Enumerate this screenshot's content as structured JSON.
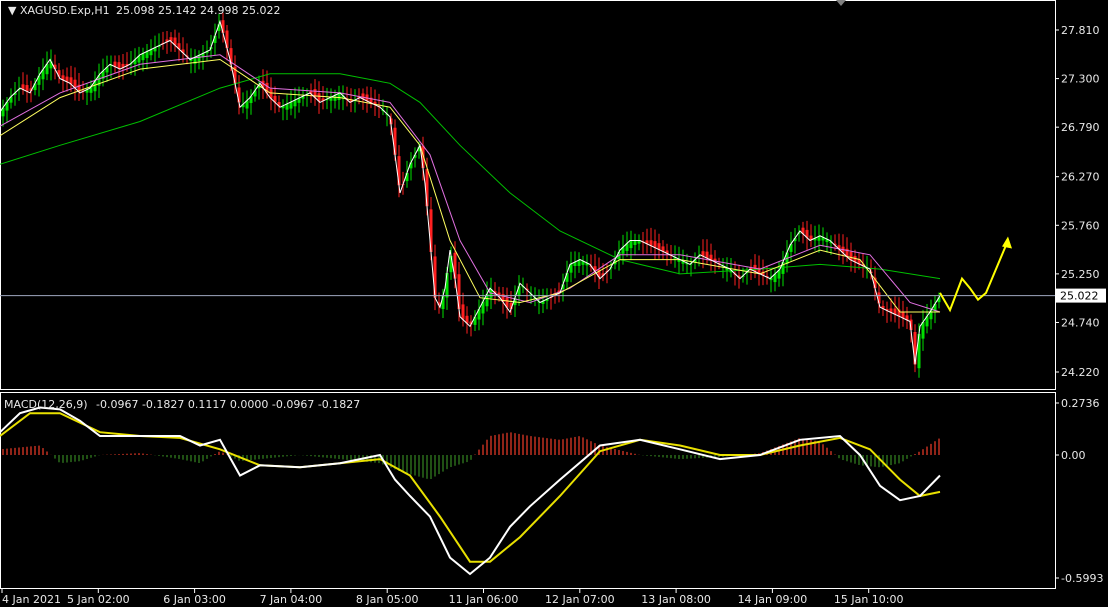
{
  "header": {
    "symbol": "XAGUSD.Exp,H1",
    "ohlc": "25.098 25.142 24.998 25.022"
  },
  "macd_header": {
    "label": "MACD(12,26,9)",
    "values": "-0.0967 -0.1827 0.1117 0.0000 -0.0967 -0.1827"
  },
  "colors": {
    "background": "#000000",
    "axis": "#ffffff",
    "bull": "#00e000",
    "bear": "#ff2020",
    "ma_fast": "#ffffff",
    "ma_mid": "#ffff60",
    "ma_slow": "#e070e0",
    "ma_long": "#00c000",
    "macd_line": "#ffffff",
    "signal_line": "#e8e000",
    "hist_pos": "#c03020",
    "hist_neg": "#2a6a1a",
    "arrow": "#ffff00",
    "current_price_line": "#a0a8c0"
  },
  "chart_data": [
    {
      "type": "candlestick",
      "title": "XAGUSD.Exp,H1",
      "ylim": [
        24.0,
        28.0
      ],
      "y_ticks": [
        "27.810",
        "27.300",
        "26.790",
        "26.270",
        "25.760",
        "25.250",
        "24.740",
        "24.220"
      ],
      "current_price": "25.022",
      "x_ticks": [
        "4 Jan 2021",
        "5 Jan 02:00",
        "6 Jan 03:00",
        "7 Jan 04:00",
        "8 Jan 05:00",
        "11 Jan 06:00",
        "12 Jan 07:00",
        "13 Jan 08:00",
        "14 Jan 09:00",
        "15 Jan 10:00"
      ],
      "close_path": [
        [
          0,
          26.95
        ],
        [
          10,
          27.1
        ],
        [
          20,
          27.2
        ],
        [
          30,
          27.15
        ],
        [
          40,
          27.35
        ],
        [
          50,
          27.5
        ],
        [
          60,
          27.3
        ],
        [
          70,
          27.25
        ],
        [
          80,
          27.15
        ],
        [
          90,
          27.2
        ],
        [
          100,
          27.35
        ],
        [
          110,
          27.45
        ],
        [
          120,
          27.4
        ],
        [
          130,
          27.45
        ],
        [
          140,
          27.55
        ],
        [
          150,
          27.6
        ],
        [
          160,
          27.65
        ],
        [
          170,
          27.7
        ],
        [
          180,
          27.6
        ],
        [
          190,
          27.5
        ],
        [
          200,
          27.55
        ],
        [
          210,
          27.6
        ],
        [
          220,
          27.9
        ],
        [
          230,
          27.5
        ],
        [
          240,
          27.0
        ],
        [
          250,
          27.1
        ],
        [
          260,
          27.25
        ],
        [
          270,
          27.1
        ],
        [
          280,
          27.0
        ],
        [
          290,
          27.05
        ],
        [
          300,
          27.1
        ],
        [
          310,
          27.15
        ],
        [
          320,
          27.05
        ],
        [
          330,
          27.1
        ],
        [
          340,
          27.15
        ],
        [
          350,
          27.05
        ],
        [
          360,
          27.1
        ],
        [
          370,
          27.05
        ],
        [
          380,
          27.0
        ],
        [
          390,
          26.9
        ],
        [
          395,
          26.5
        ],
        [
          400,
          26.1
        ],
        [
          410,
          26.4
        ],
        [
          420,
          26.6
        ],
        [
          425,
          26.2
        ],
        [
          430,
          25.6
        ],
        [
          435,
          25.0
        ],
        [
          440,
          24.9
        ],
        [
          445,
          25.1
        ],
        [
          450,
          25.5
        ],
        [
          455,
          25.2
        ],
        [
          460,
          24.8
        ],
        [
          470,
          24.7
        ],
        [
          480,
          24.9
        ],
        [
          490,
          25.1
        ],
        [
          500,
          25.0
        ],
        [
          510,
          24.85
        ],
        [
          520,
          25.15
        ],
        [
          530,
          25.05
        ],
        [
          540,
          24.95
        ],
        [
          550,
          25.0
        ],
        [
          560,
          25.05
        ],
        [
          570,
          25.35
        ],
        [
          580,
          25.4
        ],
        [
          590,
          25.35
        ],
        [
          600,
          25.2
        ],
        [
          610,
          25.3
        ],
        [
          620,
          25.5
        ],
        [
          630,
          25.6
        ],
        [
          640,
          25.6
        ],
        [
          650,
          25.55
        ],
        [
          660,
          25.5
        ],
        [
          670,
          25.45
        ],
        [
          680,
          25.4
        ],
        [
          690,
          25.35
        ],
        [
          700,
          25.45
        ],
        [
          710,
          25.4
        ],
        [
          720,
          25.35
        ],
        [
          730,
          25.3
        ],
        [
          740,
          25.2
        ],
        [
          750,
          25.3
        ],
        [
          760,
          25.25
        ],
        [
          770,
          25.2
        ],
        [
          780,
          25.3
        ],
        [
          790,
          25.55
        ],
        [
          800,
          25.7
        ],
        [
          810,
          25.6
        ],
        [
          820,
          25.65
        ],
        [
          830,
          25.6
        ],
        [
          840,
          25.5
        ],
        [
          850,
          25.4
        ],
        [
          860,
          25.35
        ],
        [
          870,
          25.3
        ],
        [
          880,
          24.9
        ],
        [
          890,
          24.85
        ],
        [
          900,
          24.8
        ],
        [
          910,
          24.75
        ],
        [
          915,
          24.3
        ],
        [
          920,
          24.7
        ],
        [
          930,
          24.85
        ],
        [
          940,
          25.02
        ]
      ],
      "ma_long": [
        [
          0,
          26.4
        ],
        [
          60,
          26.6
        ],
        [
          140,
          26.85
        ],
        [
          220,
          27.2
        ],
        [
          270,
          27.35
        ],
        [
          340,
          27.35
        ],
        [
          390,
          27.25
        ],
        [
          420,
          27.05
        ],
        [
          460,
          26.6
        ],
        [
          510,
          26.1
        ],
        [
          560,
          25.7
        ],
        [
          620,
          25.4
        ],
        [
          680,
          25.25
        ],
        [
          760,
          25.3
        ],
        [
          820,
          25.35
        ],
        [
          880,
          25.3
        ],
        [
          940,
          25.2
        ]
      ],
      "ma_mid": [
        [
          0,
          26.7
        ],
        [
          60,
          27.1
        ],
        [
          140,
          27.4
        ],
        [
          220,
          27.5
        ],
        [
          270,
          27.15
        ],
        [
          340,
          27.1
        ],
        [
          390,
          27.0
        ],
        [
          420,
          26.6
        ],
        [
          450,
          25.6
        ],
        [
          480,
          25.0
        ],
        [
          520,
          24.95
        ],
        [
          560,
          25.05
        ],
        [
          620,
          25.4
        ],
        [
          680,
          25.4
        ],
        [
          760,
          25.25
        ],
        [
          820,
          25.5
        ],
        [
          860,
          25.4
        ],
        [
          900,
          24.85
        ],
        [
          940,
          24.85
        ]
      ],
      "ma_slow": [
        [
          0,
          26.8
        ],
        [
          60,
          27.15
        ],
        [
          140,
          27.45
        ],
        [
          220,
          27.55
        ],
        [
          270,
          27.2
        ],
        [
          340,
          27.15
        ],
        [
          390,
          27.05
        ],
        [
          430,
          26.5
        ],
        [
          460,
          25.6
        ],
        [
          490,
          25.05
        ],
        [
          530,
          24.95
        ],
        [
          570,
          25.1
        ],
        [
          620,
          25.45
        ],
        [
          680,
          25.45
        ],
        [
          760,
          25.3
        ],
        [
          820,
          25.55
        ],
        [
          870,
          25.45
        ],
        [
          910,
          24.95
        ],
        [
          940,
          24.85
        ]
      ],
      "forecast_arrow": [
        [
          940,
          25.05
        ],
        [
          950,
          24.87
        ],
        [
          962,
          25.2
        ],
        [
          970,
          25.1
        ],
        [
          978,
          24.98
        ],
        [
          986,
          25.05
        ],
        [
          1008,
          25.6
        ]
      ]
    },
    {
      "type": "line",
      "title": "MACD(12,26,9)",
      "ylim": [
        -0.6,
        0.28
      ],
      "y_ticks": [
        "0.2736",
        "0.00",
        "-0.5993"
      ],
      "macd": [
        [
          0,
          0.12
        ],
        [
          20,
          0.22
        ],
        [
          40,
          0.25
        ],
        [
          60,
          0.24
        ],
        [
          80,
          0.18
        ],
        [
          100,
          0.1
        ],
        [
          140,
          0.1
        ],
        [
          180,
          0.1
        ],
        [
          200,
          0.05
        ],
        [
          220,
          0.08
        ],
        [
          240,
          -0.1
        ],
        [
          260,
          -0.05
        ],
        [
          300,
          -0.06
        ],
        [
          340,
          -0.04
        ],
        [
          380,
          0.0
        ],
        [
          395,
          -0.12
        ],
        [
          410,
          -0.2
        ],
        [
          430,
          -0.3
        ],
        [
          450,
          -0.5
        ],
        [
          470,
          -0.58
        ],
        [
          490,
          -0.5
        ],
        [
          510,
          -0.35
        ],
        [
          530,
          -0.25
        ],
        [
          560,
          -0.12
        ],
        [
          600,
          0.05
        ],
        [
          640,
          0.08
        ],
        [
          680,
          0.03
        ],
        [
          720,
          -0.02
        ],
        [
          760,
          0.0
        ],
        [
          800,
          0.08
        ],
        [
          840,
          0.1
        ],
        [
          860,
          0.0
        ],
        [
          880,
          -0.15
        ],
        [
          900,
          -0.22
        ],
        [
          920,
          -0.2
        ],
        [
          940,
          -0.1
        ]
      ],
      "signal": [
        [
          0,
          0.1
        ],
        [
          30,
          0.22
        ],
        [
          60,
          0.22
        ],
        [
          100,
          0.12
        ],
        [
          140,
          0.1
        ],
        [
          180,
          0.09
        ],
        [
          220,
          0.03
        ],
        [
          260,
          -0.05
        ],
        [
          300,
          -0.06
        ],
        [
          340,
          -0.04
        ],
        [
          380,
          -0.02
        ],
        [
          410,
          -0.1
        ],
        [
          440,
          -0.3
        ],
        [
          470,
          -0.52
        ],
        [
          490,
          -0.52
        ],
        [
          520,
          -0.4
        ],
        [
          560,
          -0.2
        ],
        [
          600,
          0.02
        ],
        [
          640,
          0.08
        ],
        [
          680,
          0.05
        ],
        [
          720,
          0.0
        ],
        [
          760,
          0.0
        ],
        [
          800,
          0.05
        ],
        [
          840,
          0.09
        ],
        [
          870,
          0.03
        ],
        [
          900,
          -0.12
        ],
        [
          920,
          -0.2
        ],
        [
          940,
          -0.18
        ]
      ],
      "histogram": [
        [
          0,
          0.03
        ],
        [
          20,
          0.04
        ],
        [
          40,
          0.05
        ],
        [
          60,
          -0.04
        ],
        [
          80,
          -0.03
        ],
        [
          100,
          0.0
        ],
        [
          140,
          0.01
        ],
        [
          180,
          -0.02
        ],
        [
          200,
          -0.04
        ],
        [
          220,
          0.02
        ],
        [
          240,
          -0.03
        ],
        [
          260,
          -0.02
        ],
        [
          300,
          0.0
        ],
        [
          340,
          -0.02
        ],
        [
          380,
          -0.04
        ],
        [
          400,
          -0.08
        ],
        [
          430,
          -0.12
        ],
        [
          450,
          -0.06
        ],
        [
          470,
          -0.03
        ],
        [
          490,
          0.1
        ],
        [
          510,
          0.12
        ],
        [
          530,
          0.1
        ],
        [
          560,
          0.08
        ],
        [
          580,
          0.1
        ],
        [
          600,
          0.05
        ],
        [
          640,
          0.0
        ],
        [
          680,
          -0.02
        ],
        [
          720,
          -0.01
        ],
        [
          760,
          0.01
        ],
        [
          800,
          0.09
        ],
        [
          820,
          0.07
        ],
        [
          840,
          -0.02
        ],
        [
          860,
          -0.05
        ],
        [
          880,
          -0.06
        ],
        [
          900,
          -0.04
        ],
        [
          920,
          0.02
        ],
        [
          940,
          0.09
        ]
      ]
    }
  ]
}
